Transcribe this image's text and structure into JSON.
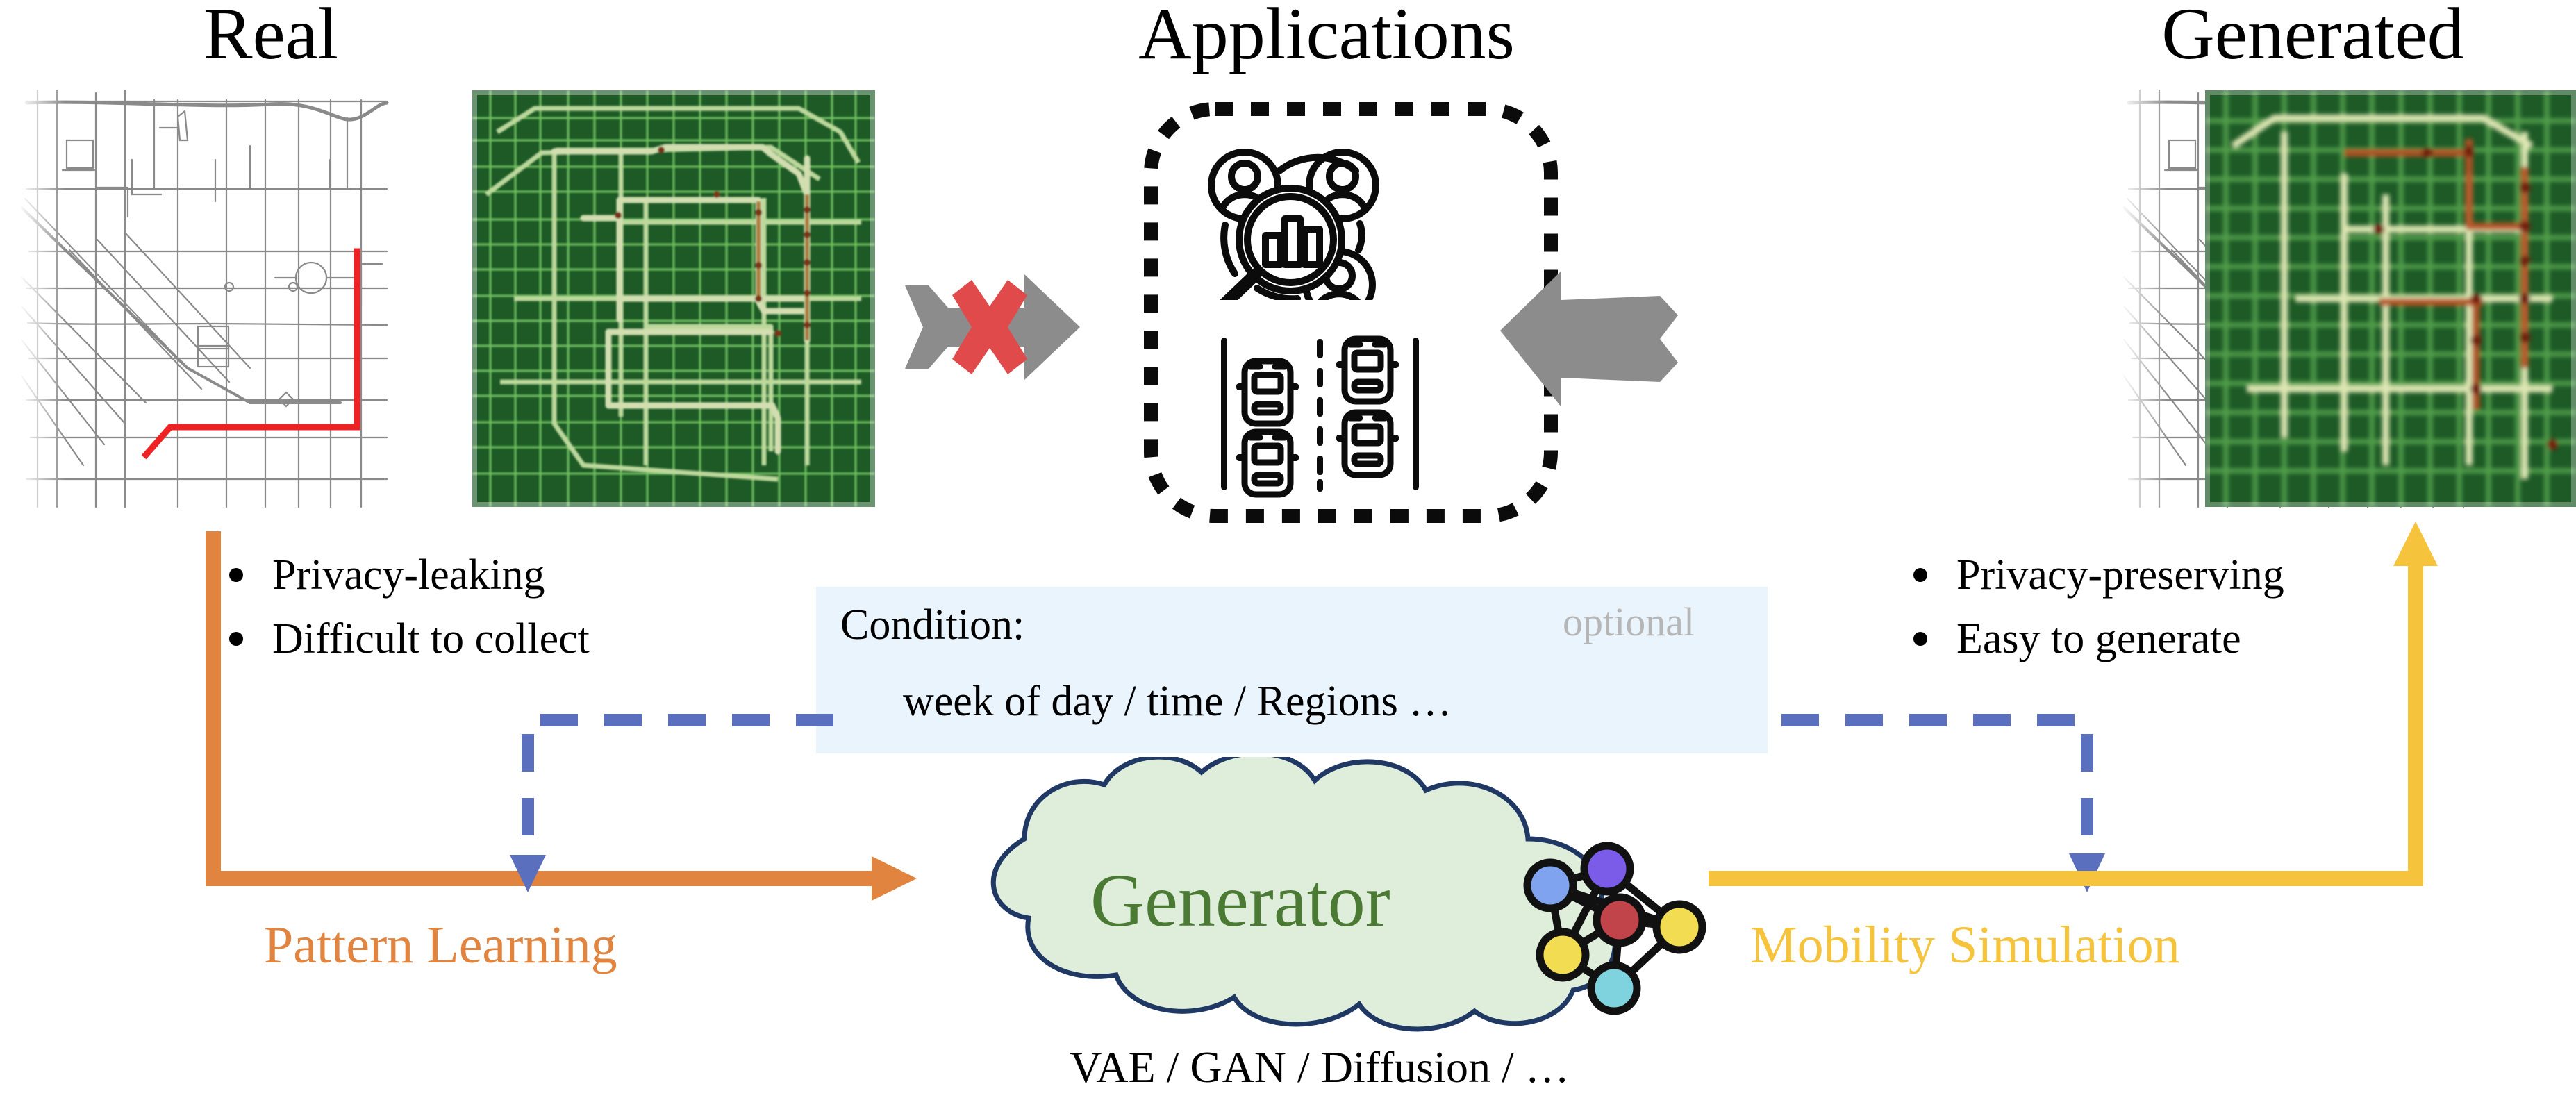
{
  "headings": {
    "left": "Real",
    "center": "Applications",
    "right": "Generated"
  },
  "left_panel": {
    "map_caption": "road-network-map-with-red-trajectory",
    "heatmap_caption": "green-traffic-density-heatmap",
    "trajectory_color": "#ee2222"
  },
  "right_panel": {
    "map_caption": "road-network-map-with-orange-trajectory",
    "heatmap_caption": "green-traffic-density-heatmap-generated",
    "trajectory_color": "#f5a623"
  },
  "applications": {
    "icon_people_analytics": "people-analytics-icon",
    "icon_traffic_lanes": "traffic-lanes-icon",
    "border_style": "dotted"
  },
  "arrows": {
    "blocked_arrow": {
      "name": "blocked-right-arrow",
      "color": "#8c8c8c",
      "cross_color": "#e04a4a",
      "cross_symbol": "X"
    },
    "allowed_arrow": {
      "name": "left-arrow",
      "color": "#8c8c8c"
    }
  },
  "bullets_left": [
    "Privacy-leaking",
    "Difficult to collect"
  ],
  "bullets_right": [
    "Privacy-preserving",
    "Easy to generate"
  ],
  "condition": {
    "label": "Condition:",
    "optional": "optional",
    "body": "week of day / time / Regions …",
    "bg_color": "#eaf4fc"
  },
  "generator": {
    "title": "Generator",
    "subtitle": "VAE / GAN / Diffusion / …",
    "title_color": "#4a7a33",
    "cloud_fill": "#dfeedb",
    "cloud_stroke": "#1f3864",
    "nn_icon": "neural-network-icon",
    "nn_node_colors": [
      "#7b5ce8",
      "#7fa3ee",
      "#c0444a",
      "#f2dd52",
      "#f2dd52",
      "#7fd3de"
    ]
  },
  "flows": {
    "left_label": "Pattern Learning",
    "left_color": "#e0843f",
    "right_label": "Mobility Simulation",
    "right_color": "#f5c43c",
    "dashed_color": "#5a6fbe"
  }
}
